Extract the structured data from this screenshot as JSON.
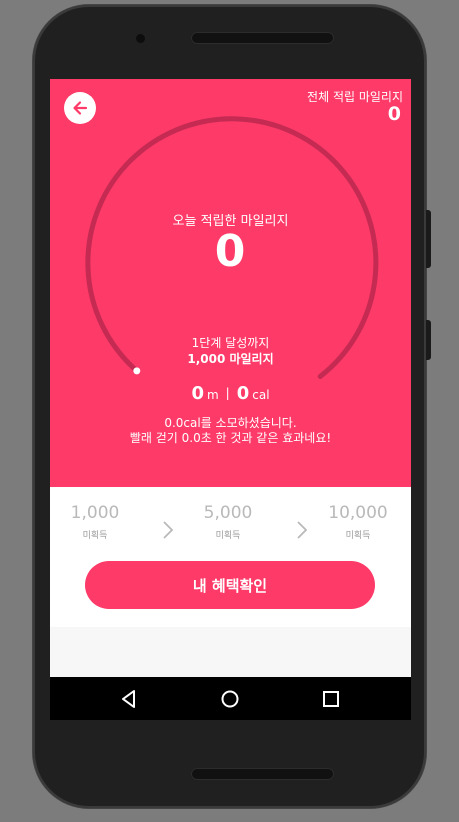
{
  "header": {
    "total_label": "전체 적립 마일리지",
    "total_value": "0"
  },
  "today": {
    "label": "오늘 적립한 마일리지",
    "value": "0"
  },
  "stage": {
    "label": "1단계 달성까지",
    "value": "1,000 마일리지"
  },
  "metrics": {
    "distance_value": "0",
    "distance_unit": "m",
    "separator": "|",
    "calorie_value": "0",
    "calorie_unit": "cal"
  },
  "message": {
    "line1": "0.0cal를 소모하셨습니다.",
    "line2": "빨래 걷기 0.0초 한 것과 같은 효과네요!"
  },
  "milestones": [
    {
      "value": "1,000",
      "state": "미획득"
    },
    {
      "value": "5,000",
      "state": "미획득"
    },
    {
      "value": "10,000",
      "state": "미획득"
    }
  ],
  "benefit_button_label": "내 혜택확인",
  "progress": 0,
  "colors": {
    "accent": "#fd3a68",
    "arc": "#c42a52",
    "milestone_text": "#b9b9b9"
  },
  "icons": {
    "back": "arrow-left-icon",
    "chevron": "chevron-right-icon",
    "nav_back": "triangle-back-icon",
    "nav_home": "circle-home-icon",
    "nav_recent": "square-recent-icon"
  }
}
